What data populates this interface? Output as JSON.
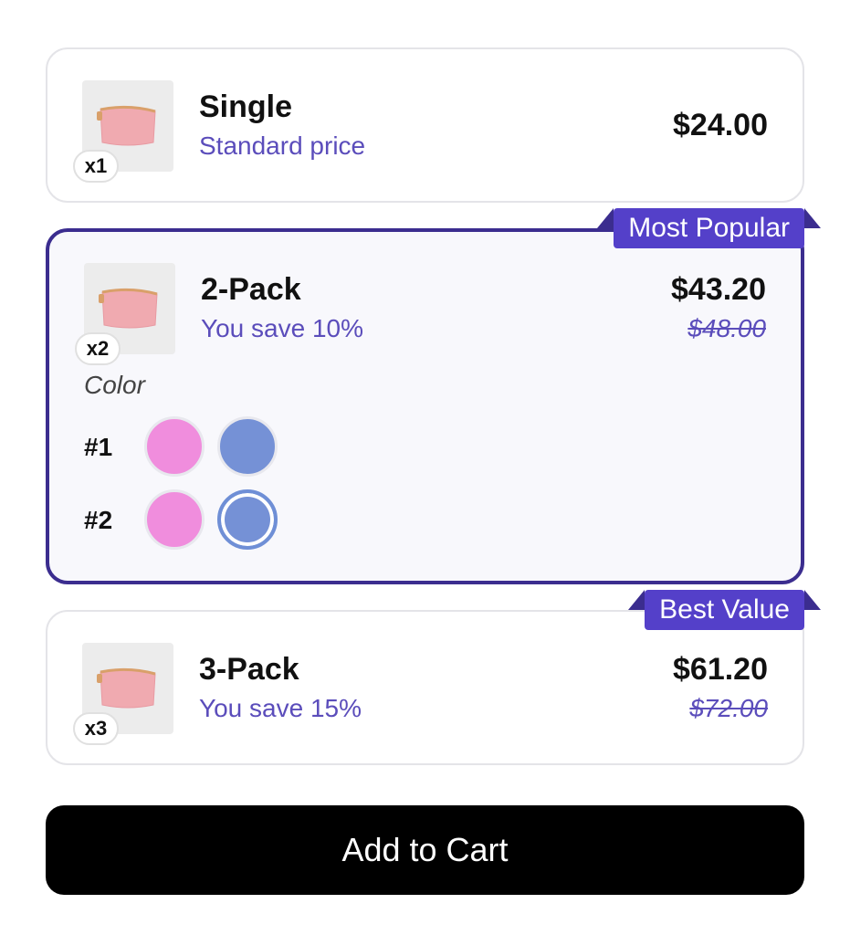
{
  "options": [
    {
      "title": "Single",
      "subtitle": "Standard price",
      "price": "$24.00",
      "quantity_badge": "x1"
    },
    {
      "title": "2-Pack",
      "subtitle": "You save 10%",
      "price": "$43.20",
      "original_price": "$48.00",
      "quantity_badge": "x2",
      "ribbon": "Most Popular",
      "color_label": "Color",
      "slots": [
        {
          "label": "#1",
          "swatches": [
            "pink",
            "blue"
          ],
          "selected": null
        },
        {
          "label": "#2",
          "swatches": [
            "pink",
            "blue"
          ],
          "selected": "blue"
        }
      ]
    },
    {
      "title": "3-Pack",
      "subtitle": "You save 15%",
      "price": "$61.20",
      "original_price": "$72.00",
      "quantity_badge": "x3",
      "ribbon": "Best Value"
    }
  ],
  "cta_label": "Add to Cart",
  "colors": {
    "accent": "#5440c9",
    "selected_border": "#3b2d8f",
    "subtitle": "#5b4dbb",
    "swatch_pink": "#f08ddd",
    "swatch_blue": "#7591d6",
    "button_bg": "#000000"
  }
}
